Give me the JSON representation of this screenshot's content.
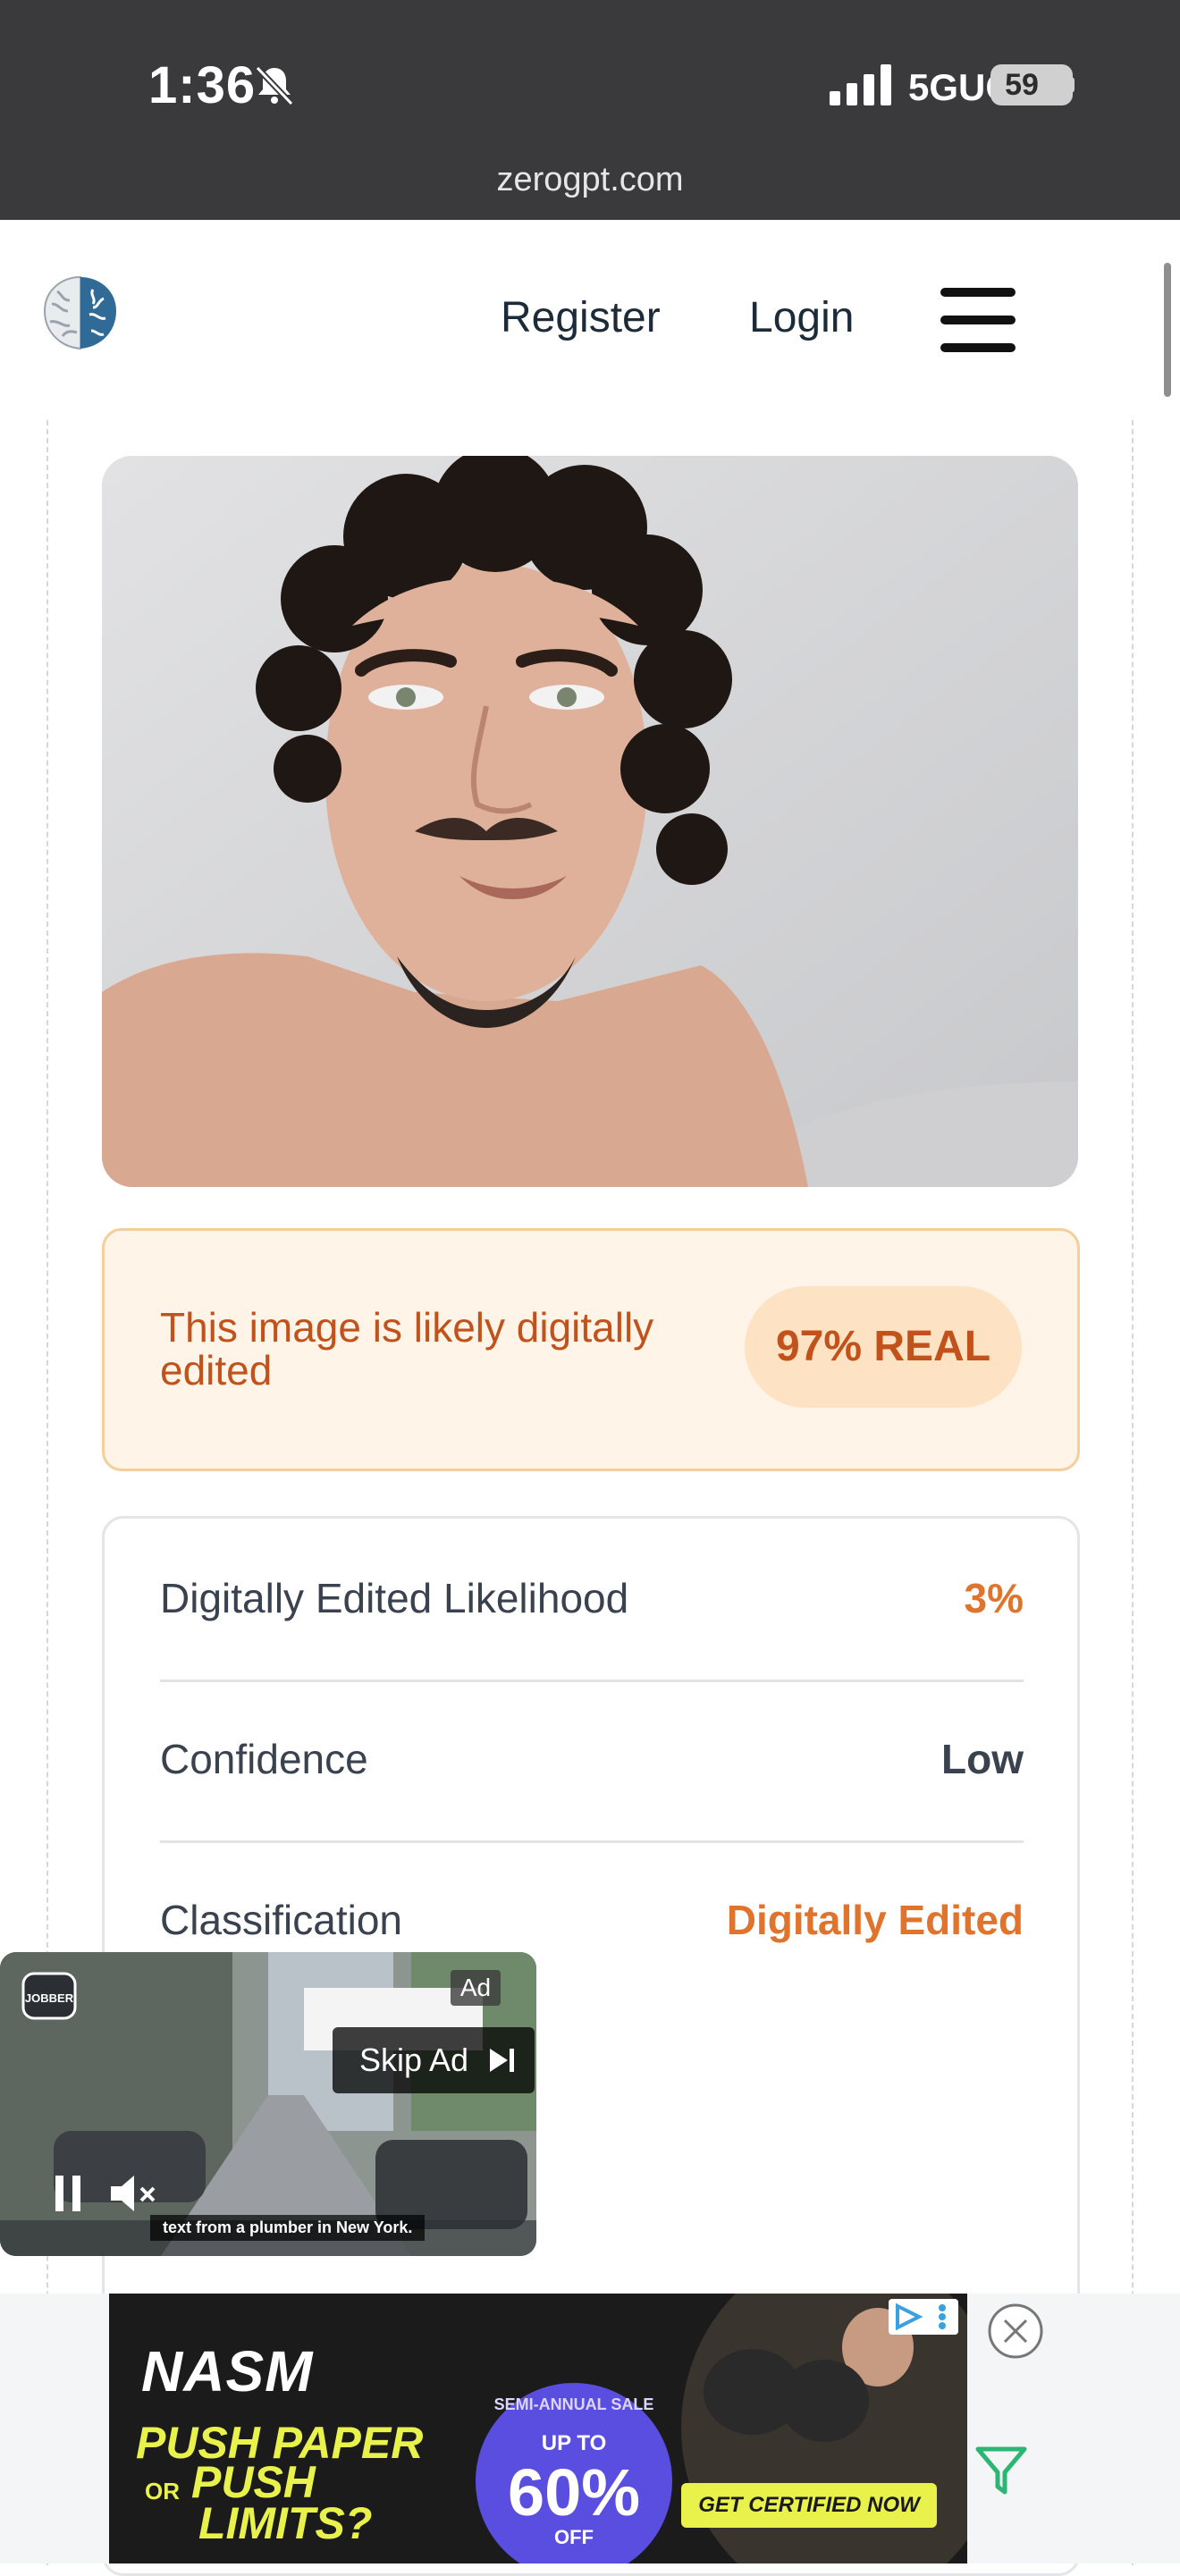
{
  "status_bar": {
    "time": "1:36",
    "network": "5GUC",
    "battery": "59"
  },
  "browser": {
    "url": "zerogpt.com"
  },
  "nav": {
    "register": "Register",
    "login": "Login"
  },
  "result": {
    "message": "This image is likely digitally edited",
    "score": "97% REAL"
  },
  "stats": [
    {
      "label": "Digitally Edited Likelihood",
      "value": "3%",
      "color": "#e0742d"
    },
    {
      "label": "Confidence",
      "value": "Low",
      "color": "#3a4250"
    },
    {
      "label": "Classification",
      "value": "Digitally Edited",
      "color": "#e0742d"
    }
  ],
  "video_ad": {
    "tag": "Ad",
    "skip": "Skip Ad",
    "caption": "text from a plumber in New York.",
    "sponsor": "JOBBER"
  },
  "banner_ad": {
    "brand": "NASM",
    "line1": "PUSH PAPER",
    "or": "OR",
    "line2": "PUSH",
    "line3": "LIMITS?",
    "ring": "SEMI-ANNUAL SALE",
    "up_to": "UP TO",
    "discount": "60%",
    "off": "OFF",
    "cta": "GET CERTIFIED NOW"
  },
  "colors": {
    "accent_orange": "#e0742d",
    "result_bg": "#fff4e7",
    "result_border": "#f4cf9b"
  }
}
